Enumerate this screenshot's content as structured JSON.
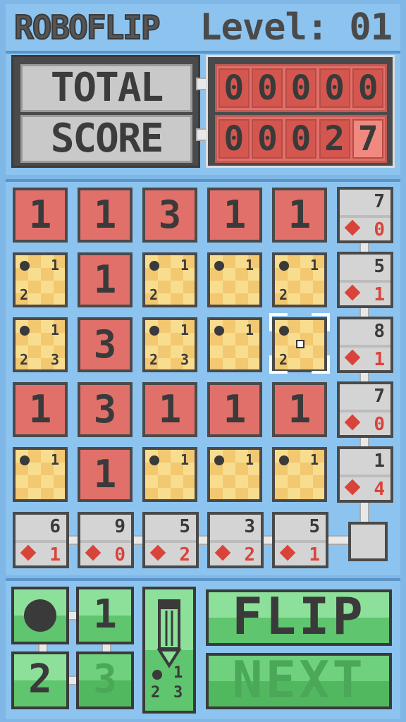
{
  "header": {
    "app_title": "ROBOFLIP",
    "level_text": "Level: 01"
  },
  "score": {
    "label_line1": "TOTAL",
    "label_line2": "SCORE",
    "total_digits": [
      "0",
      "0",
      "0",
      "0",
      "0"
    ],
    "round_digits": [
      "0",
      "0",
      "0",
      "2",
      "7"
    ]
  },
  "board": {
    "rows": [
      [
        "1",
        "1",
        "3",
        "1",
        "1"
      ],
      [
        "memo",
        "1",
        "memo",
        "memo",
        "memo"
      ],
      [
        "memo",
        "3",
        "memo",
        "memo",
        "memo"
      ],
      [
        "1",
        "3",
        "1",
        "1",
        "1"
      ],
      [
        "memo",
        "1",
        "memo",
        "memo",
        "memo"
      ]
    ],
    "memo_marks": {
      "1_0": {
        "dot": true,
        "one": "1",
        "two": "2",
        "three": ""
      },
      "1_2": {
        "dot": true,
        "one": "1",
        "two": "2",
        "three": ""
      },
      "1_3": {
        "dot": true,
        "one": "1",
        "two": "",
        "three": ""
      },
      "1_4": {
        "dot": true,
        "one": "1",
        "two": "2",
        "three": ""
      },
      "2_0": {
        "dot": true,
        "one": "1",
        "two": "2",
        "three": "3"
      },
      "2_2": {
        "dot": true,
        "one": "1",
        "two": "2",
        "three": "3"
      },
      "2_3": {
        "dot": true,
        "one": "1",
        "two": "",
        "three": ""
      },
      "2_4": {
        "dot": true,
        "one": "",
        "two": "2",
        "three": ""
      },
      "4_0": {
        "dot": true,
        "one": "1",
        "two": "",
        "three": ""
      },
      "4_2": {
        "dot": true,
        "one": "1",
        "two": "",
        "three": ""
      },
      "4_3": {
        "dot": true,
        "one": "1",
        "two": "",
        "three": ""
      },
      "4_4": {
        "dot": true,
        "one": "1",
        "two": "",
        "three": ""
      }
    },
    "selected_cell": "row 3, column 5",
    "row_hints": [
      {
        "sum": "7",
        "bombs": "0"
      },
      {
        "sum": "5",
        "bombs": "1"
      },
      {
        "sum": "8",
        "bombs": "1"
      },
      {
        "sum": "7",
        "bombs": "0"
      },
      {
        "sum": "1",
        "bombs": "4"
      }
    ],
    "col_hints": [
      {
        "sum": "6",
        "bombs": "1"
      },
      {
        "sum": "9",
        "bombs": "0"
      },
      {
        "sum": "5",
        "bombs": "2"
      },
      {
        "sum": "3",
        "bombs": "2"
      },
      {
        "sum": "5",
        "bombs": "1"
      }
    ]
  },
  "controls": {
    "memo_one": "1",
    "memo_two": "2",
    "memo_three": "3",
    "pencil_one": "1",
    "pencil_two": "2",
    "pencil_three": "3",
    "flip_label": "FLIP",
    "next_label": "NEXT"
  },
  "colors": {
    "background": "#7fb8e6",
    "tile_red": "#e2706a",
    "memo_yellow": "#f9dd8f",
    "button_green": "#8de09a",
    "bomb_red": "#d9443a"
  }
}
